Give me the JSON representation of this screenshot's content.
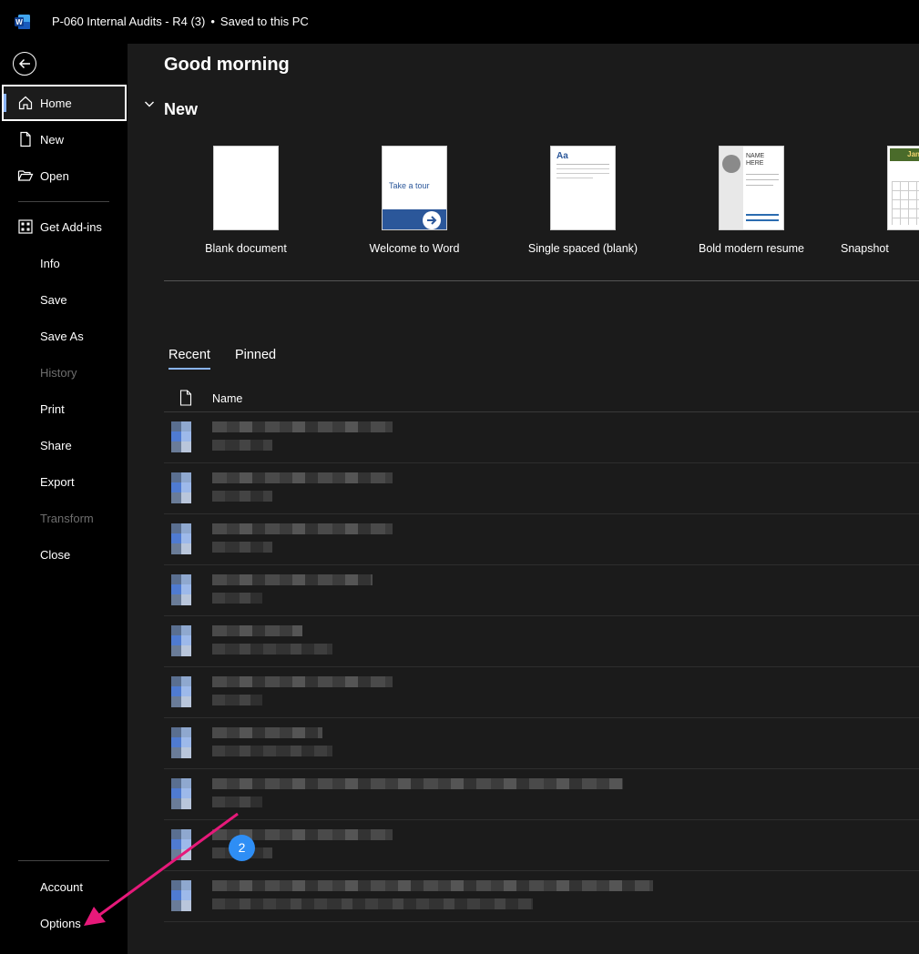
{
  "window": {
    "doc_name": "P-060 Internal Audits - R4 (3)",
    "separator": "•",
    "save_status": "Saved to this PC"
  },
  "sidebar": {
    "items": [
      {
        "label": "Home",
        "state": "active"
      },
      {
        "label": "New",
        "state": "normal"
      },
      {
        "label": "Open",
        "state": "normal"
      },
      {
        "label": "Get Add-ins",
        "state": "normal"
      },
      {
        "label": "Info",
        "state": "normal"
      },
      {
        "label": "Save",
        "state": "normal"
      },
      {
        "label": "Save As",
        "state": "normal"
      },
      {
        "label": "History",
        "state": "disabled"
      },
      {
        "label": "Print",
        "state": "normal"
      },
      {
        "label": "Share",
        "state": "normal"
      },
      {
        "label": "Export",
        "state": "normal"
      },
      {
        "label": "Transform",
        "state": "disabled"
      },
      {
        "label": "Close",
        "state": "normal"
      }
    ],
    "bottom": [
      {
        "label": "Account"
      },
      {
        "label": "Options"
      }
    ]
  },
  "main": {
    "greeting": "Good morning",
    "new_section_title": "New",
    "templates": [
      {
        "name": "Blank document"
      },
      {
        "name": "Welcome to Word",
        "thumb_text": "Take a tour"
      },
      {
        "name": "Single spaced (blank)",
        "thumb_text": "Aa"
      },
      {
        "name": "Bold modern resume",
        "thumb_text_1": "NAME",
        "thumb_text_2": "HERE"
      },
      {
        "name": "Snapshot calendar",
        "thumb_text": "January"
      }
    ],
    "tabs": [
      {
        "label": "Recent",
        "active": true
      },
      {
        "label": "Pinned",
        "active": false
      }
    ],
    "list_header": {
      "name_col": "Name"
    },
    "recent_count": 10
  },
  "annotation": {
    "badge": "2",
    "arrow_color": "#e6197a"
  },
  "colors": {
    "accent": "#8ab4f8",
    "word_blue": "#185abd",
    "badge_blue": "#2e8ef5"
  }
}
